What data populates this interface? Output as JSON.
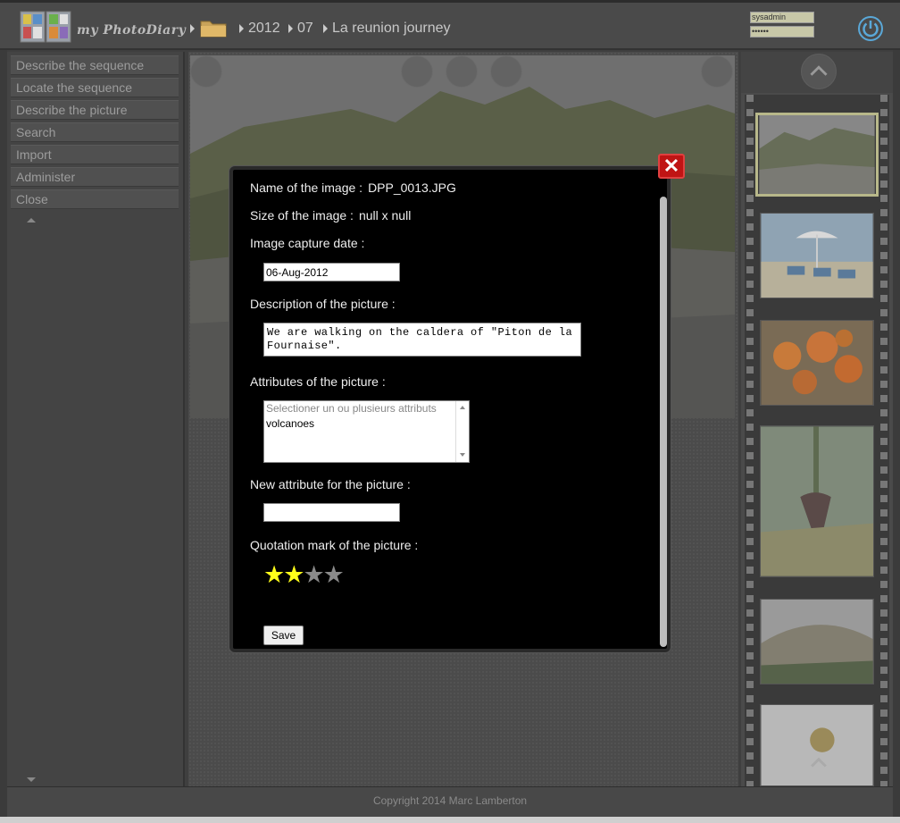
{
  "header": {
    "app_name": "my PhotoDiary",
    "breadcrumb": [
      "2012",
      "07",
      "La reunion journey"
    ],
    "login": {
      "user": "sysadmin",
      "password": "••••••"
    }
  },
  "menu": {
    "items": [
      "Describe the sequence",
      "Locate the sequence",
      "Describe the picture",
      "Search",
      "Import",
      "Administer",
      "Close"
    ]
  },
  "modal": {
    "name_label": "Name of the image :",
    "name_value": "DPP_0013.JPG",
    "size_label": "Size of the image :",
    "size_value": "null x null",
    "date_label": "Image capture date :",
    "date_value": "06-Aug-2012",
    "description_label": "Description of the picture :",
    "description_value": "We are walking on the caldera of \"Piton de la Fournaise\".",
    "attributes_label": "Attributes of the picture :",
    "attributes_placeholder": "Selectioner un ou plusieurs attributs",
    "attributes_values": [
      "volcanoes"
    ],
    "new_attribute_label": "New attribute for the picture :",
    "new_attribute_value": "",
    "rating_label": "Quotation mark of the picture :",
    "rating": {
      "value": 2,
      "max": 4
    },
    "save_label": "Save",
    "close_glyph": "✕"
  },
  "footer": {
    "copyright": "Copyright 2014 Marc Lamberton"
  },
  "colors": {
    "star_on": "#ffff1a",
    "star_off": "#8a8a8a",
    "close_button": "#c01414",
    "selected_thumb_border": "#b8b88a"
  }
}
